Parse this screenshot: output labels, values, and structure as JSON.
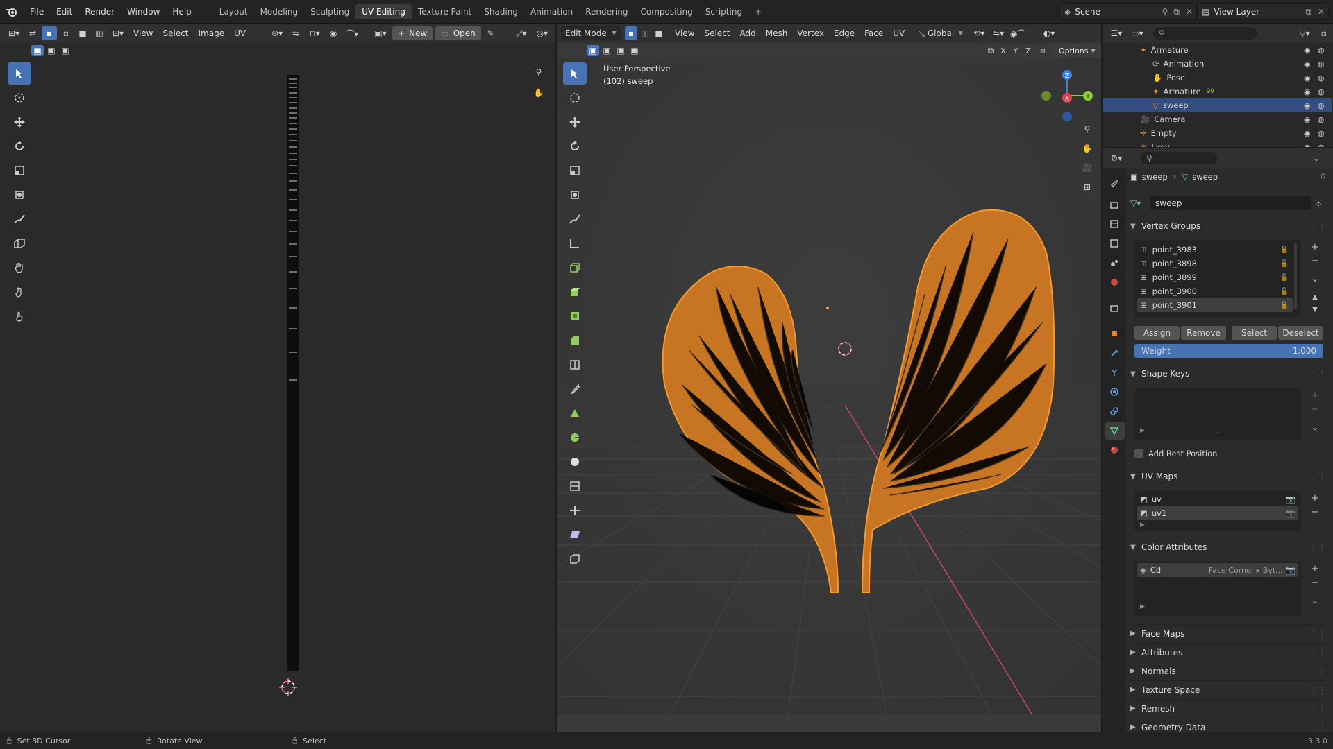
{
  "menus": [
    "File",
    "Edit",
    "Render",
    "Window",
    "Help"
  ],
  "workspaces": [
    "Layout",
    "Modeling",
    "Sculpting",
    "UV Editing",
    "Texture Paint",
    "Shading",
    "Animation",
    "Rendering",
    "Compositing",
    "Scripting"
  ],
  "active_workspace": "UV Editing",
  "scene": {
    "label": "Scene"
  },
  "view_layer": {
    "label": "View Layer"
  },
  "uv_editor": {
    "menus": [
      "View",
      "Select",
      "Image",
      "UV"
    ],
    "new_label": "New",
    "open_label": "Open"
  },
  "viewport": {
    "mode": "Edit Mode",
    "menus": [
      "View",
      "Select",
      "Add",
      "Mesh",
      "Vertex",
      "Edge",
      "Face",
      "UV"
    ],
    "transform": "Global",
    "options": "Options",
    "axes": [
      "X",
      "Y",
      "Z"
    ],
    "overlay_line1": "User Perspective",
    "overlay_line2": "(102) sweep",
    "gizmo": {
      "z": "Z",
      "y": "Y",
      "x": "X"
    }
  },
  "outliner": {
    "rows": [
      {
        "label": "Armature",
        "indent": 3,
        "icon": "armature",
        "sel": false
      },
      {
        "label": "Animation",
        "indent": 4,
        "icon": "action",
        "sel": false
      },
      {
        "label": "Pose",
        "indent": 4,
        "icon": "pose",
        "sel": false
      },
      {
        "label": "Armature",
        "indent": 4,
        "icon": "armature",
        "sel": false,
        "extra": "99"
      },
      {
        "label": "sweep",
        "indent": 4,
        "icon": "mesh",
        "sel": true
      },
      {
        "label": "Camera",
        "indent": 3,
        "icon": "camera",
        "sel": false
      },
      {
        "label": "Empty",
        "indent": 3,
        "icon": "empty",
        "sel": false
      },
      {
        "label": "Lkey",
        "indent": 3,
        "icon": "light",
        "sel": false
      }
    ]
  },
  "properties": {
    "breadcrumb_object": "sweep",
    "breadcrumb_data": "sweep",
    "mesh_name": "sweep",
    "vertex_groups_title": "Vertex Groups",
    "vertex_groups": [
      "point_3983",
      "point_3898",
      "point_3899",
      "point_3900",
      "point_3901"
    ],
    "vg_buttons": [
      "Assign",
      "Remove",
      "Select",
      "Deselect"
    ],
    "weight_label": "Weight",
    "weight_value": "1.000",
    "shape_keys_title": "Shape Keys",
    "add_rest_position": "Add Rest Position",
    "uv_maps_title": "UV Maps",
    "uv_maps": [
      "uv",
      "uv1"
    ],
    "color_attributes_title": "Color Attributes",
    "color_attr_name": "Cd",
    "color_attr_domain": "Face Corner ▸ Byt...",
    "collapsed_sections": [
      "Face Maps",
      "Attributes",
      "Normals",
      "Texture Space",
      "Remesh",
      "Geometry Data"
    ]
  },
  "status": {
    "left": "Set 3D Cursor",
    "mid": "Rotate View",
    "right": "Select",
    "version": "3.3.0"
  },
  "colors": {
    "accent": "#4772b3",
    "selection_orange": "#ff8c1a",
    "x_axis": "#e0404f",
    "y_axis": "#8bcd3a",
    "z_axis": "#3b82e0"
  }
}
